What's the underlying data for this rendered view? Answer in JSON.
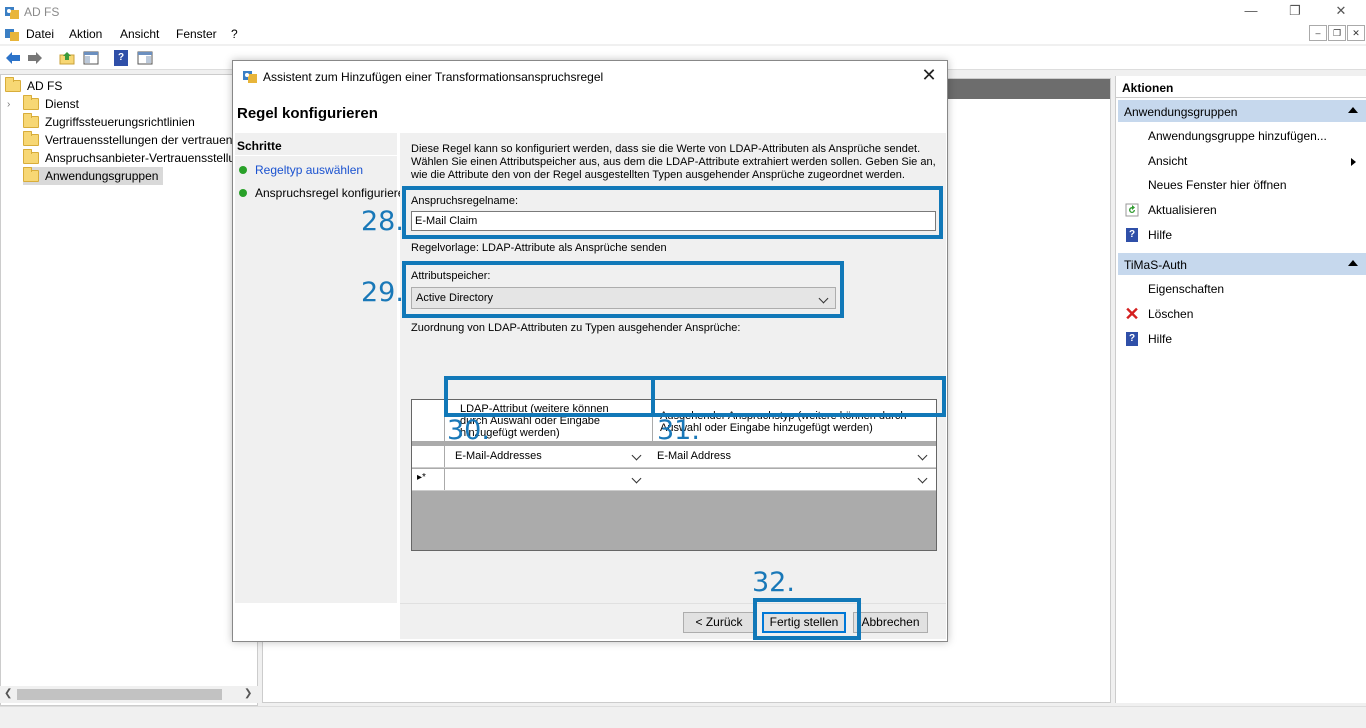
{
  "window": {
    "title": "AD FS",
    "icon": "adfs-icon"
  },
  "window_controls": [
    "—",
    "❐",
    "✕"
  ],
  "mdi_controls": [
    "–",
    "❐",
    "✕"
  ],
  "menu": [
    "Datei",
    "Aktion",
    "Ansicht",
    "Fenster",
    "?"
  ],
  "toolbar_icons": [
    "back-arrow-icon",
    "forward-arrow-icon",
    "up-folder-icon",
    "show-hide-tree-icon",
    "help-icon",
    "show-hide-action-pane-icon"
  ],
  "tree": {
    "root": "AD FS",
    "items": [
      "Dienst",
      "Zugriffssteuerungsrichtlinien",
      "Vertrauensstellungen der vertrauenden",
      "Anspruchsanbieter-Vertrauensstellungen",
      "Anwendungsgruppen"
    ],
    "selected": "Anwendungsgruppen"
  },
  "actions": {
    "title": "Aktionen",
    "groups": [
      {
        "name": "Anwendungsgruppen",
        "items": [
          {
            "label": "Anwendungsgruppe hinzufügen...",
            "icon": ""
          },
          {
            "label": "Ansicht",
            "icon": "",
            "submenu": true
          },
          {
            "label": "Neues Fenster hier öffnen",
            "icon": ""
          },
          {
            "label": "Aktualisieren",
            "icon": "refresh-icon"
          },
          {
            "label": "Hilfe",
            "icon": "help-icon"
          }
        ]
      },
      {
        "name": "TiMaS-Auth",
        "items": [
          {
            "label": "Eigenschaften",
            "icon": ""
          },
          {
            "label": "Löschen",
            "icon": "delete-icon"
          },
          {
            "label": "Hilfe",
            "icon": "help-icon"
          }
        ]
      }
    ]
  },
  "dialog": {
    "title": "Assistent zum Hinzufügen einer Transformationsanspruchsregel",
    "heading": "Regel konfigurieren",
    "steps_title": "Schritte",
    "steps": [
      "Regeltyp auswählen",
      "Anspruchsregel konfigurieren"
    ],
    "intro": "Diese Regel kann so konfiguriert werden, dass sie die Werte von LDAP-Attributen als Ansprüche sendet. Wählen Sie einen Attributspeicher aus, aus dem die LDAP-Attribute extrahiert werden sollen. Geben Sie an, wie die Attribute den von der Regel ausgestellten Typen ausgehender Ansprüche zugeordnet werden.",
    "claim_name_label": "Anspruchsregelname:",
    "claim_name_value": "E-Mail Claim",
    "template_text": "Regelvorlage: LDAP-Attribute als Ansprüche senden",
    "store_label": "Attributspeicher:",
    "store_value": "Active Directory",
    "mapping_label": "Zuordnung von LDAP-Attributen zu Typen ausgehender Ansprüche:",
    "grid": {
      "col1_header": "LDAP-Attribut (weitere können durch Auswahl oder Eingabe hinzugefügt werden)",
      "col2_header": "Ausgehender Anspruchstyp (weitere können durch Auswahl oder Eingabe hinzugefügt werden)",
      "row1": {
        "ldap": "E-Mail-Addresses",
        "claim": "E-Mail Address"
      },
      "new_row_marker": "▸*"
    },
    "buttons": {
      "back": "< Zurück",
      "finish": "Fertig stellen",
      "cancel": "Abbrechen"
    }
  },
  "annotations": [
    "28.",
    "29.",
    "30.",
    "31.",
    "32."
  ],
  "colors": {
    "annotation": "#1178b8",
    "selection": "#c6d8ed",
    "link": "#1a52d0"
  }
}
